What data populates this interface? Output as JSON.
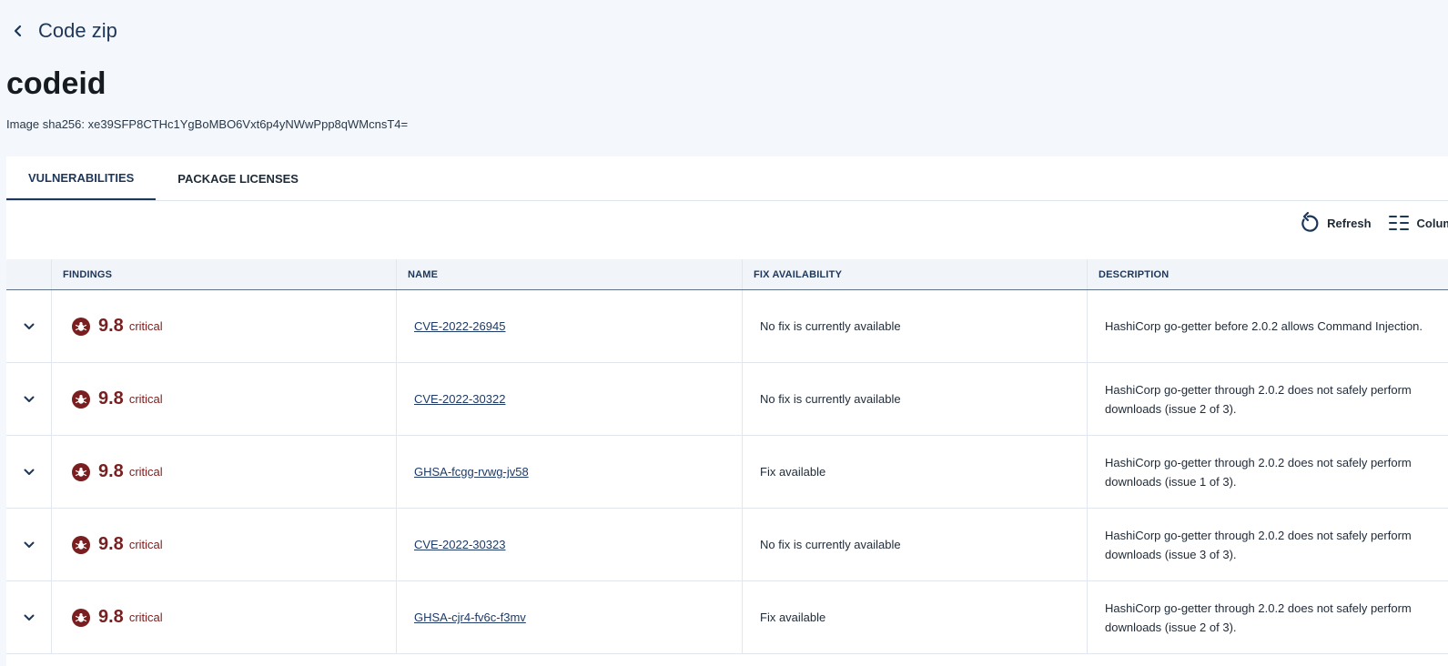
{
  "header": {
    "back_title": "Code zip",
    "page_title": "codeid",
    "sha_line": "Image sha256: xe39SFP8CTHc1YgBoMBO6Vxt6p4yNWwPpp8qWMcnsT4="
  },
  "tabs": [
    {
      "label": "VULNERABILITIES",
      "active": true
    },
    {
      "label": "PACKAGE LICENSES",
      "active": false
    }
  ],
  "toolbar": {
    "refresh_label": "Refresh",
    "columns_label": "Colum"
  },
  "table": {
    "headers": [
      "FINDINGS",
      "NAME",
      "FIX AVAILABILITY",
      "DESCRIPTION"
    ],
    "rows": [
      {
        "score": "9.8",
        "severity": "critical",
        "name": "CVE-2022-26945",
        "fix": "No fix is currently available",
        "description": "HashiCorp go-getter before 2.0.2 allows Command Injection."
      },
      {
        "score": "9.8",
        "severity": "critical",
        "name": "CVE-2022-30322",
        "fix": "No fix is currently available",
        "description": "HashiCorp go-getter through 2.0.2 does not safely perform downloads (issue 2 of 3)."
      },
      {
        "score": "9.8",
        "severity": "critical",
        "name": "GHSA-fcgg-rvwg-jv58",
        "fix": "Fix available",
        "description": "HashiCorp go-getter through 2.0.2 does not safely perform downloads (issue 1 of 3)."
      },
      {
        "score": "9.8",
        "severity": "critical",
        "name": "CVE-2022-30323",
        "fix": "No fix is currently available",
        "description": "HashiCorp go-getter through 2.0.2 does not safely perform downloads (issue 3 of 3)."
      },
      {
        "score": "9.8",
        "severity": "critical",
        "name": "GHSA-cjr4-fv6c-f3mv",
        "fix": "Fix available",
        "description": "HashiCorp go-getter through 2.0.2 does not safely perform downloads (issue 2 of 3)."
      }
    ]
  },
  "colors": {
    "accent": "#1e3658",
    "critical": "#7a1f1f",
    "page_bg": "#f4f8fc"
  },
  "icons": {
    "back": "chevron-left-icon",
    "refresh": "refresh-icon",
    "columns": "columns-icon",
    "expand": "chevron-down-icon",
    "severity": "bug-icon"
  }
}
